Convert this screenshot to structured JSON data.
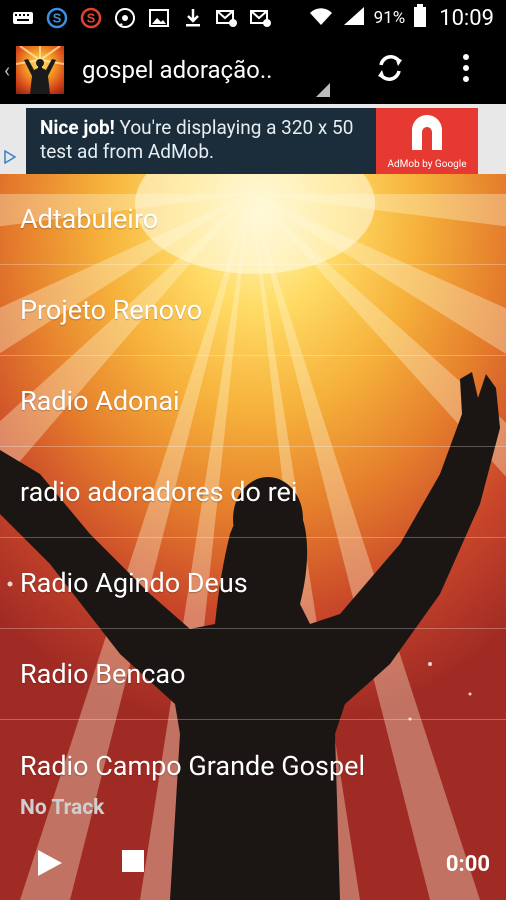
{
  "status_bar": {
    "battery_percent": "91%",
    "time": "10:09"
  },
  "action_bar": {
    "title": "gospel adoração..",
    "icons": [
      "app-logo",
      "refresh-icon",
      "overflow-menu-icon"
    ]
  },
  "ad": {
    "headline": "Nice job!",
    "text": " You're displaying a 320 x 50 test ad from AdMob.",
    "caption": "AdMob by Google",
    "colors": {
      "background": "#1b2d3a",
      "logo_bg": "#e63931"
    }
  },
  "stations": [
    "Adtabuleiro",
    "Projeto Renovo",
    "Radio Adonai",
    "radio adoradores do rei",
    "Radio Agindo Deus",
    "Radio Bencao",
    "Radio Campo Grande Gospel"
  ],
  "player": {
    "track": "No Track",
    "time": "0:00"
  }
}
